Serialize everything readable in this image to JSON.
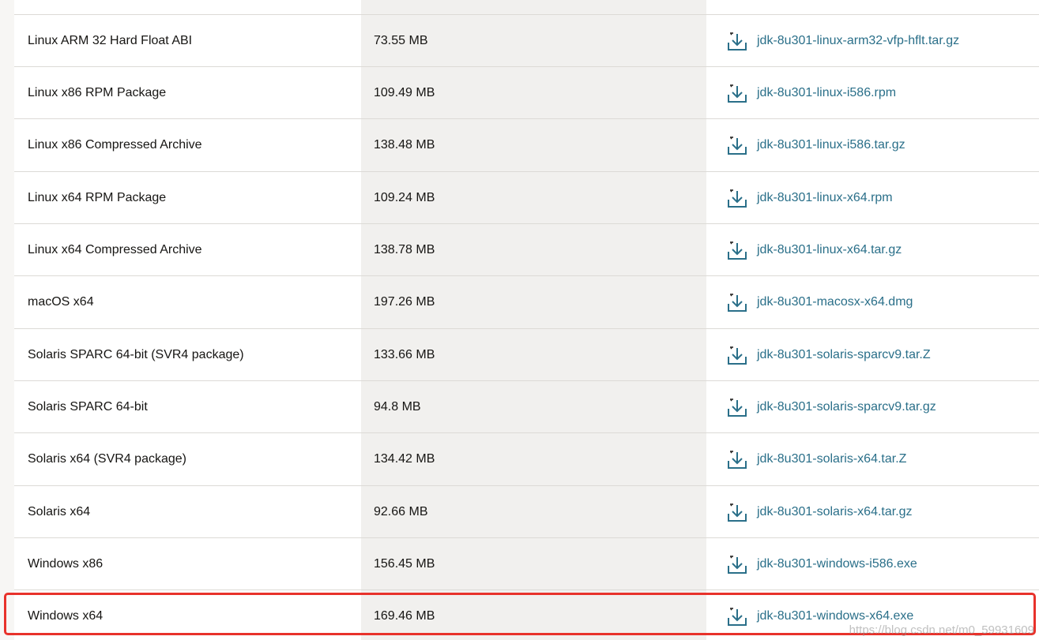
{
  "rows": [
    {
      "product": "Linux ARM 32 Hard Float ABI",
      "size": "73.55 MB",
      "file": "jdk-8u301-linux-arm32-vfp-hflt.tar.gz"
    },
    {
      "product": "Linux x86 RPM Package",
      "size": "109.49 MB",
      "file": "jdk-8u301-linux-i586.rpm"
    },
    {
      "product": "Linux x86 Compressed Archive",
      "size": "138.48 MB",
      "file": "jdk-8u301-linux-i586.tar.gz"
    },
    {
      "product": "Linux x64 RPM Package",
      "size": "109.24 MB",
      "file": "jdk-8u301-linux-x64.rpm"
    },
    {
      "product": "Linux x64 Compressed Archive",
      "size": "138.78 MB",
      "file": "jdk-8u301-linux-x64.tar.gz"
    },
    {
      "product": "macOS x64",
      "size": "197.26 MB",
      "file": "jdk-8u301-macosx-x64.dmg"
    },
    {
      "product": "Solaris SPARC 64-bit (SVR4 package)",
      "size": "133.66 MB",
      "file": "jdk-8u301-solaris-sparcv9.tar.Z"
    },
    {
      "product": "Solaris SPARC 64-bit",
      "size": "94.8 MB",
      "file": "jdk-8u301-solaris-sparcv9.tar.gz"
    },
    {
      "product": "Solaris x64 (SVR4 package)",
      "size": "134.42 MB",
      "file": "jdk-8u301-solaris-x64.tar.Z"
    },
    {
      "product": "Solaris x64",
      "size": "92.66 MB",
      "file": "jdk-8u301-solaris-x64.tar.gz"
    },
    {
      "product": "Windows x86",
      "size": "156.45 MB",
      "file": "jdk-8u301-windows-i586.exe"
    },
    {
      "product": "Windows x64",
      "size": "169.46 MB",
      "file": "jdk-8u301-windows-x64.exe"
    }
  ],
  "watermark": "https://blog.csdn.net/m0_59931609",
  "colors": {
    "link": "#2a6f89",
    "highlight": "#e8322b",
    "size_column_bg": "#f1f0ee"
  },
  "icons": {
    "download": "download-icon"
  }
}
